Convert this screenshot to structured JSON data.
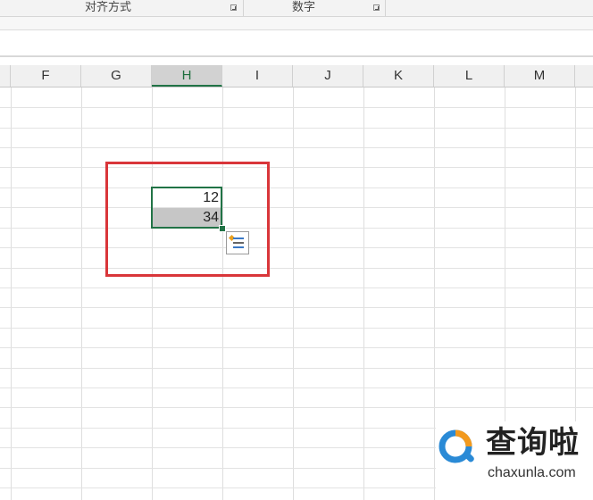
{
  "ribbon": {
    "groups": [
      {
        "label": "对齐方式"
      },
      {
        "label": "数字"
      }
    ]
  },
  "columns": [
    "F",
    "G",
    "H",
    "I",
    "J",
    "K",
    "L",
    "M"
  ],
  "selected_column": "H",
  "cells": {
    "H1": "12",
    "H2": "34"
  },
  "watermark": {
    "title": "查询啦",
    "subtitle": "chaxunla.com"
  },
  "colors": {
    "selection": "#217346",
    "highlight": "#d9363a",
    "watermark_orange": "#f39a1e",
    "watermark_blue": "#2a8ad6"
  }
}
